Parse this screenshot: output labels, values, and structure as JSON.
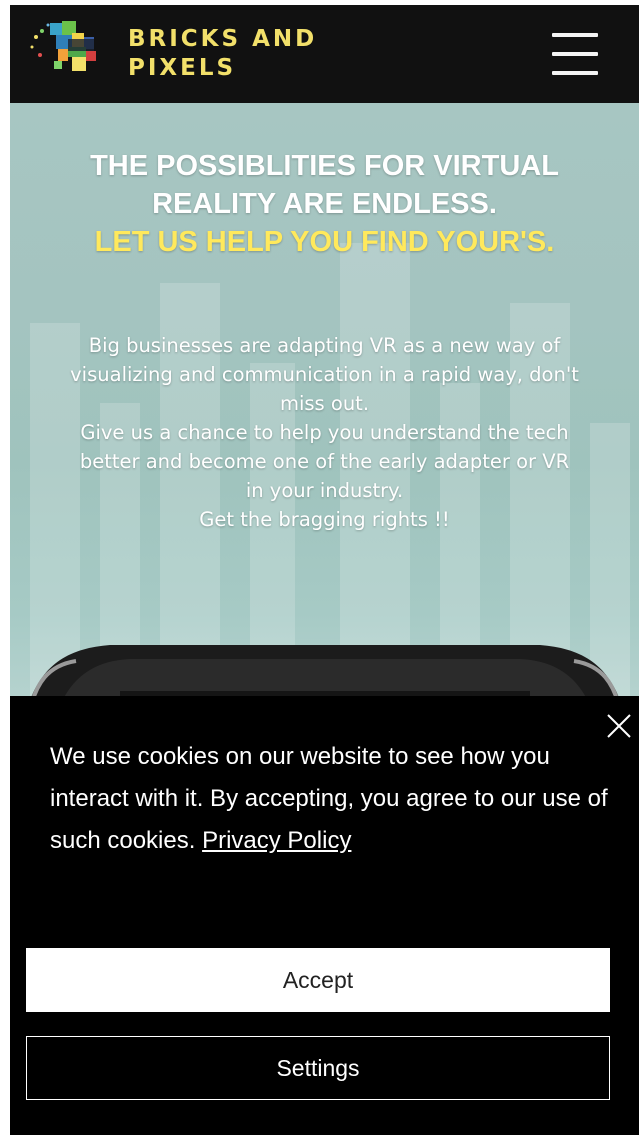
{
  "header": {
    "brand_line1": "BRICKS AND",
    "brand_line2": "PIXELS",
    "menu_icon": "hamburger-menu-icon",
    "logo_icon": "vr-headset-logo-icon"
  },
  "hero": {
    "title_line1": "THE POSSIBLITIES FOR VIRTUAL",
    "title_line2": "REALITY ARE ENDLESS.",
    "title_line3": "LET US HELP YOU FIND YOUR'S.",
    "paragraph_line1": "Big businesses are adapting VR as a new way of",
    "paragraph_line2": "visualizing and communication in a rapid way, don't",
    "paragraph_line3": "miss out.",
    "paragraph_line4": "Give us a chance to help you understand the tech",
    "paragraph_line5": "better and  become one of the early adapter or VR",
    "paragraph_line6": "in your industry.",
    "paragraph_line7": "Get the bragging rights !!"
  },
  "cookie_banner": {
    "text": "We use cookies on our website to see how you interact with it. By accepting, you agree to our use of such cookies. ",
    "privacy_link": "Privacy Policy",
    "accept_label": "Accept",
    "settings_label": "Settings",
    "close_icon": "close-icon"
  },
  "colors": {
    "accent_yellow": "#ffe95c",
    "brand_gold": "#f2e06a",
    "header_bg": "#111111",
    "banner_bg": "#000000"
  }
}
